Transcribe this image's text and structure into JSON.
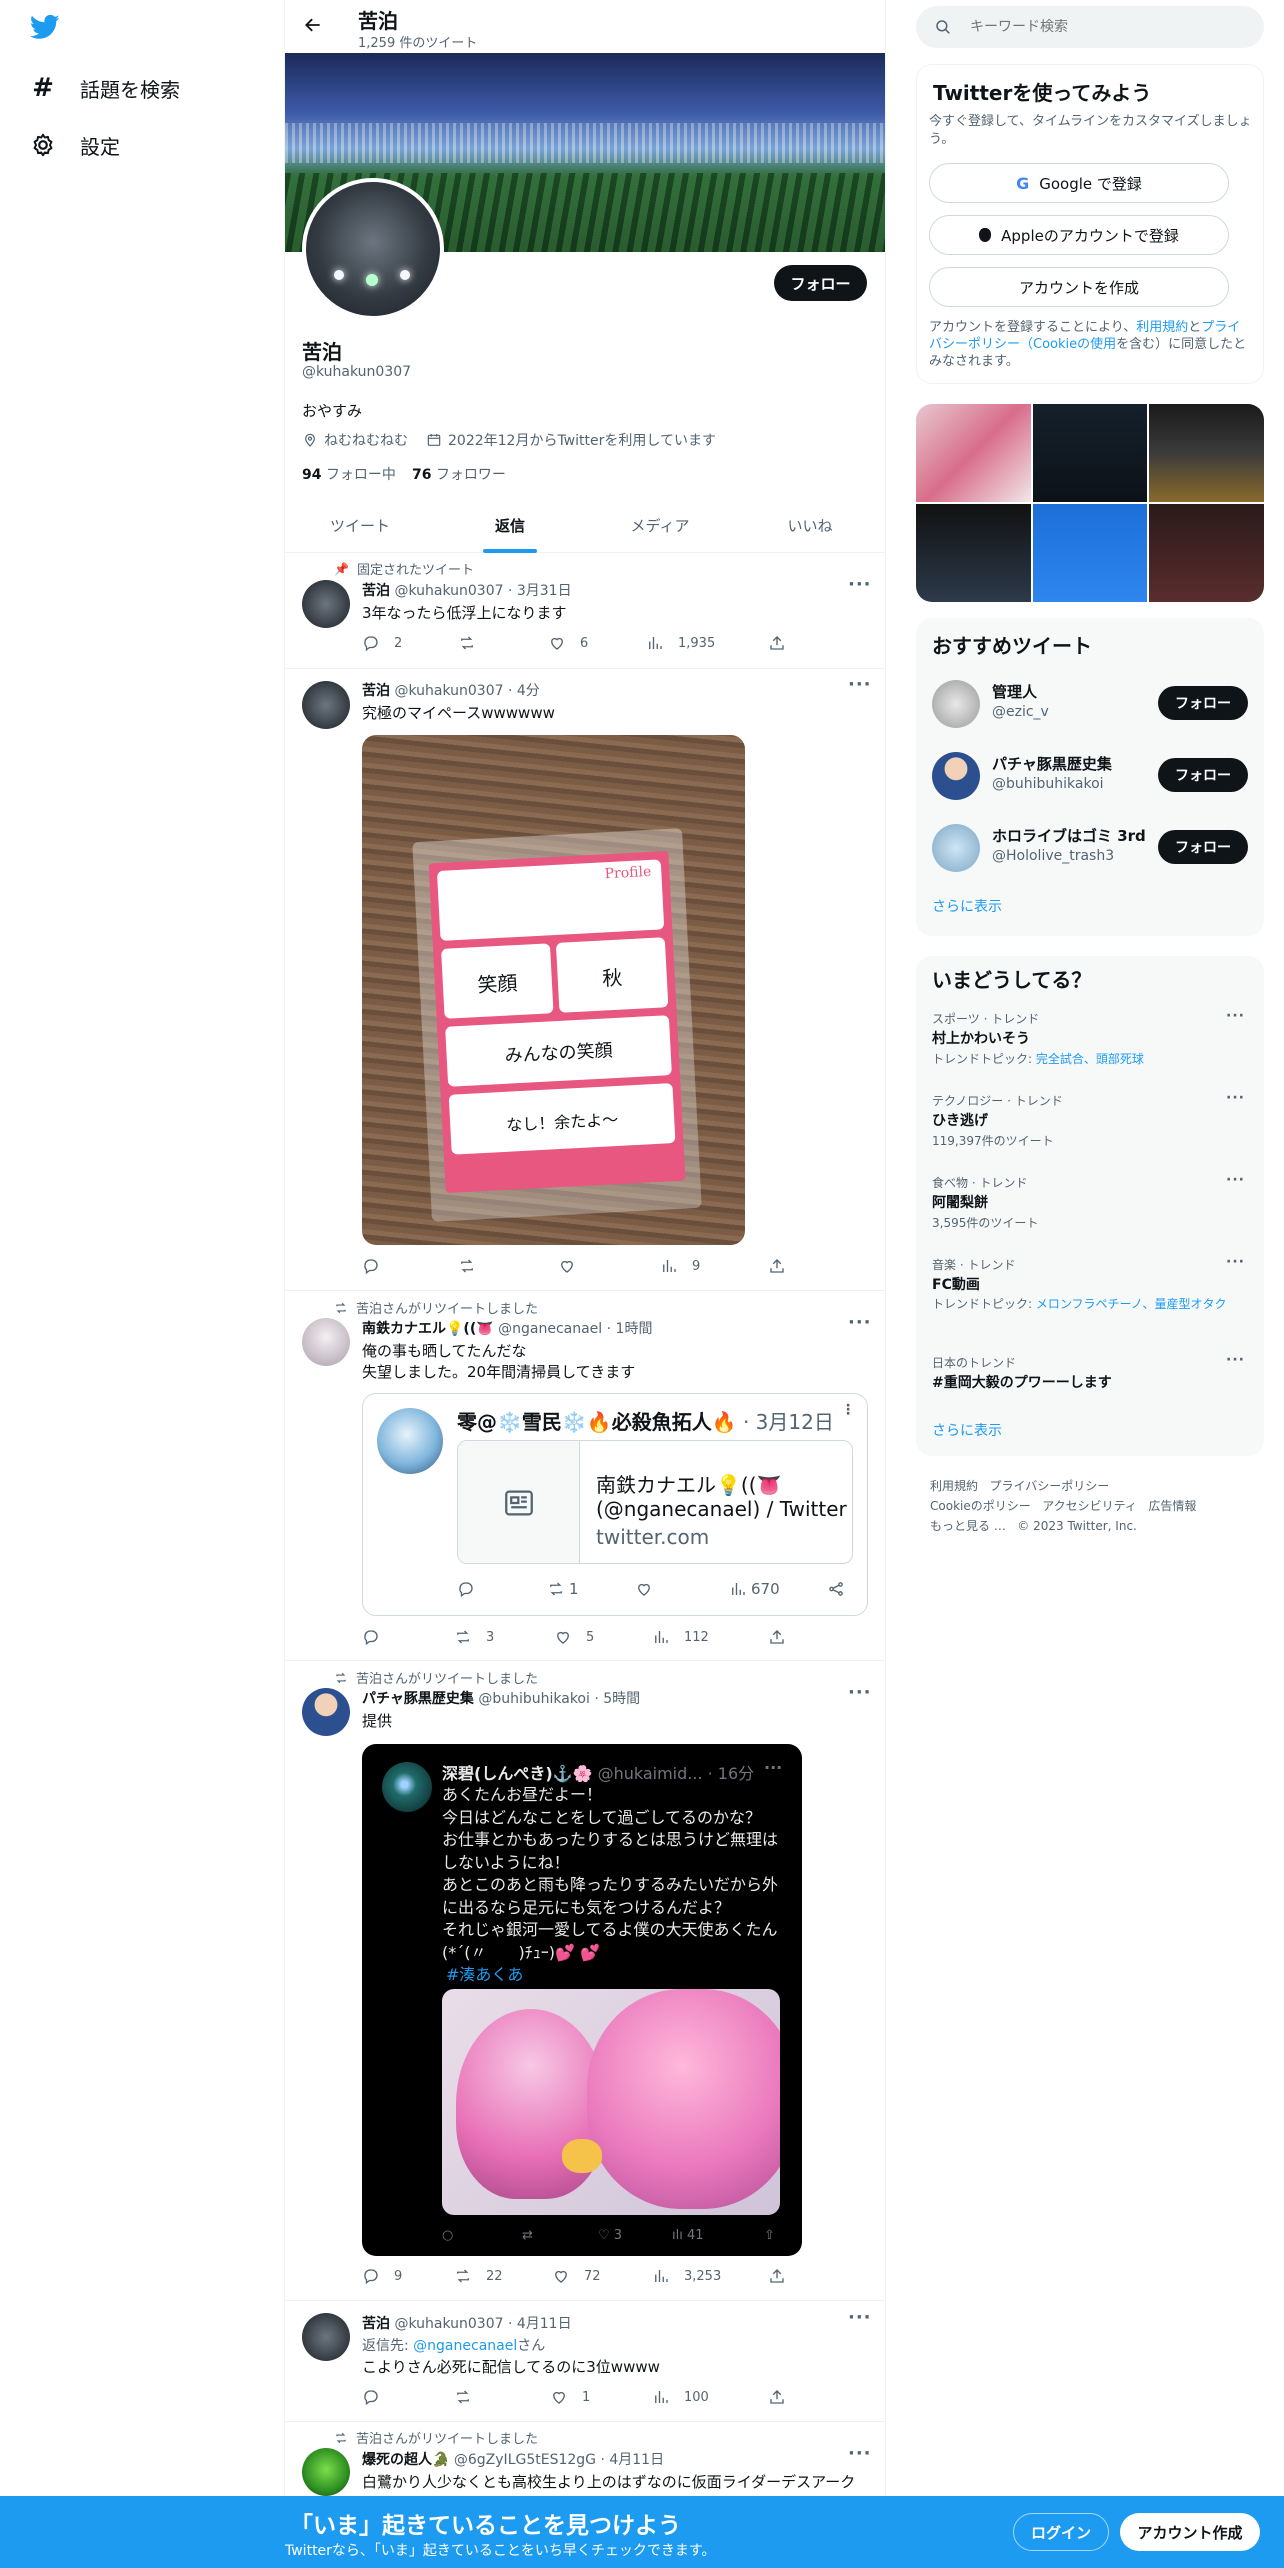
{
  "left_nav": {
    "items": [
      {
        "icon": "hashtag-icon",
        "label": "話題を検索"
      },
      {
        "icon": "gear-icon",
        "label": "設定"
      }
    ]
  },
  "header": {
    "name": "苦泊",
    "tweet_count": "1,259 件のツイート"
  },
  "profile": {
    "name": "苦泊",
    "handle": "@kuhakun0307",
    "bio": "おやすみ",
    "location": "ねむねむねむ",
    "joined": "2022年12月からTwitterを利用しています",
    "following_count": "94",
    "following_label": "フォロー中",
    "followers_count": "76",
    "followers_label": "フォロワー",
    "follow_button": "フォロー"
  },
  "tabs": [
    "ツイート",
    "返信",
    "メディア",
    "いいね"
  ],
  "tweets": [
    {
      "pinned_label": "固定されたツイート",
      "name": "苦泊",
      "meta": "@kuhakun0307 · 3月31日",
      "text": "3年なったら低浮上になります",
      "replies": "2",
      "retweets": "",
      "likes": "6",
      "views": "1,935"
    },
    {
      "name": "苦泊",
      "meta": "@kuhakun0307 · 4分",
      "text": "究極のマイペースwwwwww",
      "replies": "",
      "retweets": "",
      "likes": "",
      "views": "9",
      "image_text": {
        "title": "Profile",
        "line1": "笑顔",
        "line2": "秋",
        "line3": "みんなの笑顔",
        "line4": "なし！余たよ〜"
      }
    },
    {
      "rt_label": "苦泊さんがリツイートしました",
      "name": "南鉄カナエル💡((👅",
      "meta": "@nganecanael · 1時間",
      "text1": "俺の事も晒してたんだな",
      "text2": "失望しました。20年間清掃員してきます",
      "replies": "",
      "retweets": "3",
      "likes": "5",
      "views": "112",
      "embed": {
        "author": "零@❄️雪民❄️🔥必殺魚拓人🔥",
        "date": "· 3月12日",
        "card_title1": "南鉄カナエル💡((👅",
        "card_title2": "(@nganecanael) / Twitter",
        "card_domain": "twitter.com",
        "retweets": "1",
        "views": "670"
      }
    },
    {
      "rt_label": "苦泊さんがリツイートしました",
      "name": "パチャ豚黒歴史集",
      "meta": "@buhibuhikakoi · 5時間",
      "text": "提供",
      "replies": "9",
      "retweets": "22",
      "likes": "72",
      "views": "3,253",
      "embed": {
        "author": "深碧(しんぺき)⚓️🌸",
        "handle": "@hukaimid... · 16分",
        "lines": [
          "あくたんお昼だよー！",
          "今日はどんなことをして過ごしてるのかな？",
          "お仕事とかもあったりするとは思うけど無理は",
          "しないようにね！",
          "あとこのあと雨も降ったりするみたいだから外",
          "に出るなら足元にも気をつけるんだよ？",
          "それじゃ銀河一愛してるよ僕の大天使あくたん",
          "(*´(〃　　)ﾁｭｰ)💕 💕"
        ],
        "hashtag": "#湊あくあ",
        "likes": "3",
        "views": "41"
      }
    },
    {
      "name": "苦泊",
      "meta": "@kuhakun0307 · 4月11日",
      "reply_prefix": "返信先: ",
      "reply_to": "@nganecanael",
      "reply_suffix": "さん",
      "text": "こよりさん必死に配信してるのに3位wwww",
      "replies": "",
      "retweets": "",
      "likes": "1",
      "views": "100"
    },
    {
      "rt_label": "苦泊さんがリツイートしました",
      "name": "爆死の超人🐊",
      "meta": "@6gZyILG5tES12gG · 4月11日",
      "text": "白鷺かり人少なくとも高校生より上のはずなのに仮面ライダーデスアーク"
    }
  ],
  "search": {
    "placeholder": "キーワード検索"
  },
  "signup": {
    "title": "Twitterを使ってみよう",
    "subtitle": "今すぐ登録して、タイムラインをカスタマイズしましょう。",
    "google": "Google で登録",
    "apple": "Appleのアカウントで登録",
    "create": "アカウントを作成",
    "legal_1": "アカウントを登録することにより、",
    "legal_terms": "利用規約",
    "legal_2": "と",
    "legal_privacy": "プライバシーポリシー（Cookieの使用",
    "legal_3": "を含む）に同意したとみなされます。"
  },
  "recommended": {
    "title": "おすすめツイート",
    "users": [
      {
        "name": "管理人",
        "handle": "@ezic_v",
        "button": "フォロー"
      },
      {
        "name": "パチャ豚黒歴史集",
        "handle": "@buhibuhikakoi",
        "button": "フォロー"
      },
      {
        "name": "ホロライブはゴミ 3rd",
        "handle": "@Hololive_trash3",
        "button": "フォロー"
      }
    ],
    "more": "さらに表示"
  },
  "trends": {
    "title": "いまどうしてる？",
    "items": [
      {
        "category": "スポーツ · トレンド",
        "name": "村上かわいそう",
        "sub_prefix": "トレンドトピック: ",
        "sub_link": "完全試合、頭部死球"
      },
      {
        "category": "テクノロジー · トレンド",
        "name": "ひき逃げ",
        "sub": "119,397件のツイート"
      },
      {
        "category": "食べ物 · トレンド",
        "name": "阿闍梨餅",
        "sub": "3,595件のツイート"
      },
      {
        "category": "音楽 · トレンド",
        "name": "FC動画",
        "sub_prefix": "トレンドトピック: ",
        "sub_link": "メロンフラペチーノ、量産型オタク"
      },
      {
        "category": "日本のトレンド",
        "name": "#重岡大毅のプワーーします"
      }
    ],
    "more": "さらに表示"
  },
  "footer": {
    "links": [
      "利用規約",
      "プライバシーポリシー",
      "Cookieのポリシー",
      "アクセシビリティ",
      "広告情報",
      "もっと見る …",
      "© 2023 Twitter, Inc."
    ]
  },
  "bottom_bar": {
    "title": "「いま」起きていることを見つけよう",
    "subtitle": "Twitterなら、「いま」起きていることをいち早くチェックできます。",
    "login": "ログイン",
    "signup": "アカウント作成"
  },
  "colors": {
    "accent": "#1d9bf0",
    "bottom_bar": "#1d9bf0",
    "text": "#0f1419",
    "muted": "#536471"
  }
}
